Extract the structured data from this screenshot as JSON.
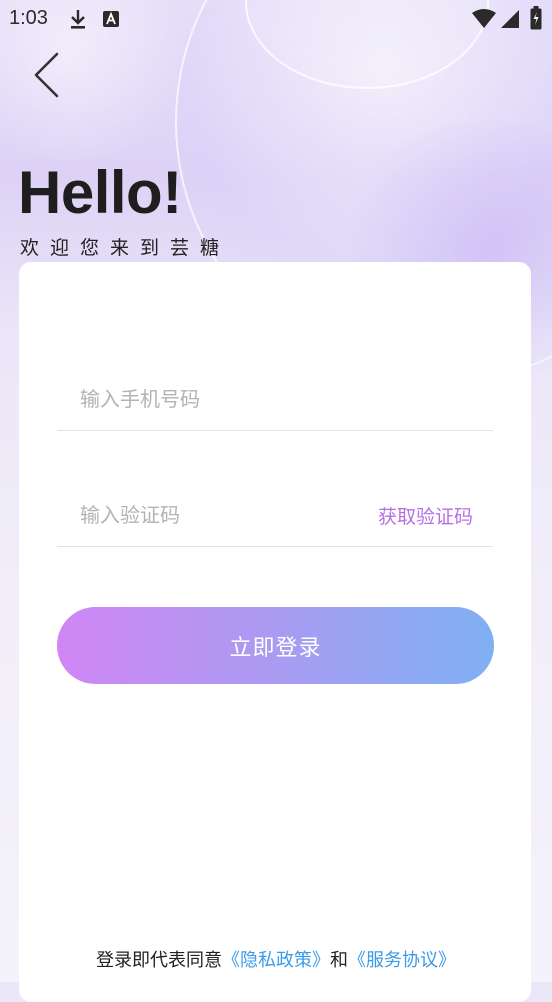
{
  "status_bar": {
    "time": "1:03",
    "icons": [
      "download-icon",
      "a-notification-icon",
      "wifi-icon",
      "signal-icon",
      "battery-icon"
    ]
  },
  "header": {
    "back_icon": "chevron-left-icon",
    "title": "Hello!",
    "subtitle": "欢迎您来到芸糖"
  },
  "form": {
    "phone_placeholder": "输入手机号码",
    "phone_value": "",
    "code_placeholder": "输入验证码",
    "code_value": "",
    "get_code_label": "获取验证码",
    "submit_label": "立即登录"
  },
  "footer": {
    "prefix": "登录即代表同意",
    "privacy_link": "《隐私政策》",
    "conjunction": "和",
    "service_link": "《服务协议》"
  },
  "colors": {
    "accent_purple": "#b571e3",
    "link_blue": "#3b9be8",
    "button_gradient_start": "#d086f4",
    "button_gradient_end": "#7fb0f4"
  }
}
